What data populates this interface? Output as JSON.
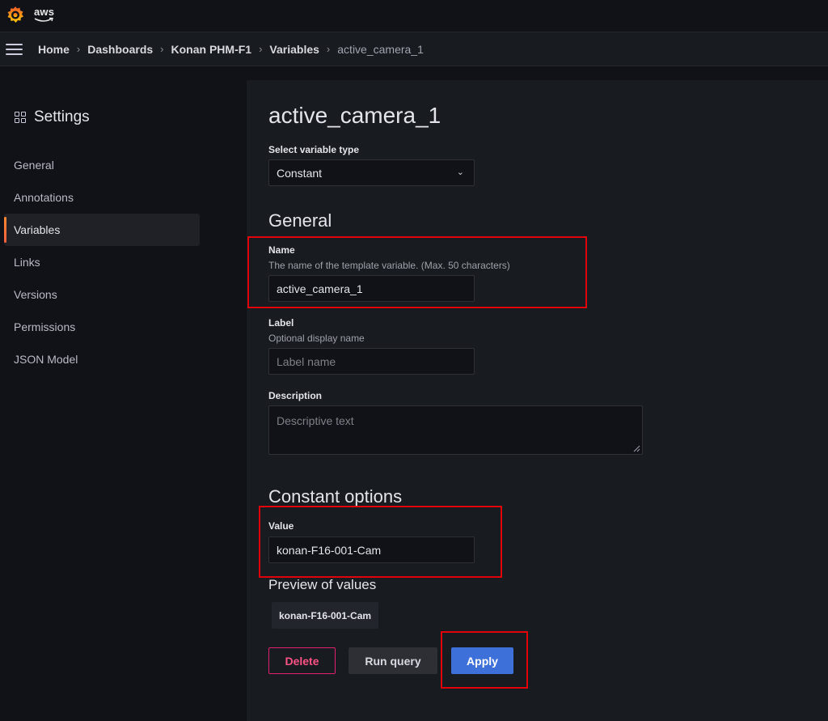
{
  "topbar": {
    "logo_icon": "grafana-logo-icon",
    "aws_label": "aws"
  },
  "breadcrumbs": [
    "Home",
    "Dashboards",
    "Konan PHM-F1",
    "Variables",
    "active_camera_1"
  ],
  "sidebar": {
    "title": "Settings",
    "items": [
      {
        "label": "General",
        "active": false
      },
      {
        "label": "Annotations",
        "active": false
      },
      {
        "label": "Variables",
        "active": true
      },
      {
        "label": "Links",
        "active": false
      },
      {
        "label": "Versions",
        "active": false
      },
      {
        "label": "Permissions",
        "active": false
      },
      {
        "label": "JSON Model",
        "active": false
      }
    ]
  },
  "main": {
    "title": "active_camera_1",
    "variable_type": {
      "label": "Select variable type",
      "value": "Constant"
    },
    "general": {
      "heading": "General",
      "name": {
        "label": "Name",
        "description": "The name of the template variable. (Max. 50 characters)",
        "value": "active_camera_1"
      },
      "label_field": {
        "label": "Label",
        "description": "Optional display name",
        "placeholder": "Label name"
      },
      "description_field": {
        "label": "Description",
        "placeholder": "Descriptive text"
      }
    },
    "constant_options": {
      "heading": "Constant options",
      "value_label": "Value",
      "value": "konan-F16-001-Cam"
    },
    "preview": {
      "heading": "Preview of values",
      "values": [
        "konan-F16-001-Cam"
      ]
    },
    "buttons": {
      "delete": "Delete",
      "run_query": "Run query",
      "apply": "Apply"
    }
  },
  "colors": {
    "highlight": "#e0000a",
    "apply": "#3d71d9",
    "delete": "#e0226e",
    "active_accent": "#ff8833"
  }
}
